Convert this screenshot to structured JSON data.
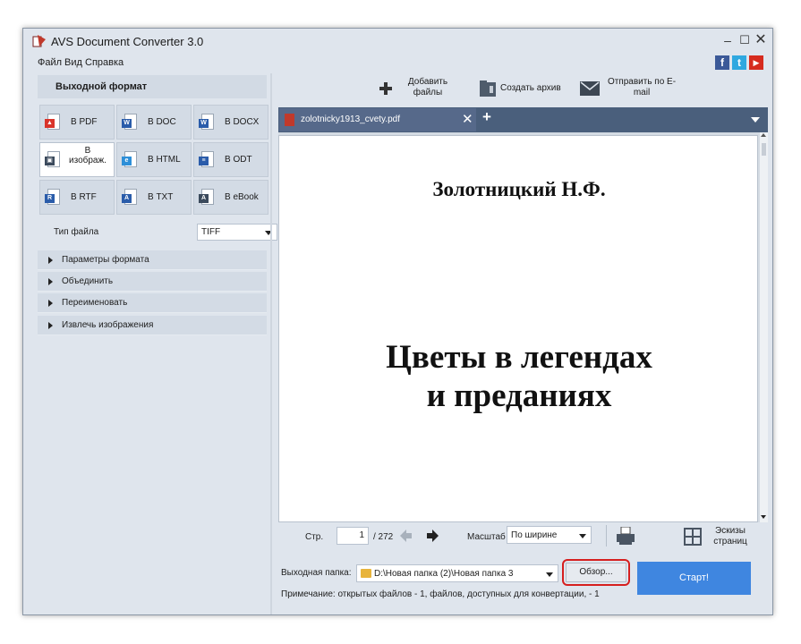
{
  "window": {
    "title": "AVS Document Converter 3.0"
  },
  "menu": [
    "Файл",
    "Вид",
    "Справка"
  ],
  "social_icons": [
    "facebook-icon",
    "twitter-icon",
    "youtube-icon"
  ],
  "left_panel": {
    "header": "Выходной формат",
    "formats": [
      {
        "label": "В PDF",
        "icon": "pdf-icon",
        "color": "#d9342b",
        "selected": false
      },
      {
        "label": "В DOC",
        "icon": "doc-icon",
        "color": "#2a5caa",
        "selected": false
      },
      {
        "label": "В DOCX",
        "icon": "docx-icon",
        "color": "#2a5caa",
        "selected": false
      },
      {
        "label": "В изображ.",
        "icon": "image-icon",
        "color": "#3b4a5c",
        "selected": true
      },
      {
        "label": "В HTML",
        "icon": "html-icon",
        "color": "#2d8fd8",
        "selected": false
      },
      {
        "label": "В ODT",
        "icon": "odt-icon",
        "color": "#2a5caa",
        "selected": false
      },
      {
        "label": "В RTF",
        "icon": "rtf-icon",
        "color": "#2a5caa",
        "selected": false
      },
      {
        "label": "В TXT",
        "icon": "txt-icon",
        "color": "#2a5caa",
        "selected": false
      },
      {
        "label": "В eBook",
        "icon": "ebook-icon",
        "color": "#3b4a5c",
        "selected": false
      }
    ],
    "file_type": {
      "label": "Тип файла",
      "value": "TIFF"
    },
    "sections": [
      "Параметры формата",
      "Объединить",
      "Переименовать",
      "Извлечь изображения"
    ]
  },
  "toolbar": {
    "add_files": "Добавить файлы",
    "create_archive": "Создать архив",
    "send_email": "Отправить по E-mail"
  },
  "document": {
    "tab_name": "zolotnicky1913_cvety.pdf",
    "author": "Золотницкий Н.Ф.",
    "title_line1": "Цветы в легендах",
    "title_line2": "и преданиях"
  },
  "navigation": {
    "page_label": "Стр.",
    "current_page": "1",
    "total_pages": "/ 272",
    "zoom_label": "Масштаб",
    "zoom_value": "По ширине",
    "thumbnails_label": "Эскизы страниц"
  },
  "output": {
    "folder_label": "Выходная папка:",
    "folder_path": "D:\\Новая папка (2)\\Новая папка 3",
    "browse_label": "Обзор...",
    "start_label": "Старт!",
    "note": "Примечание: открытых файлов - 1, файлов, доступных для конвертации, - 1"
  },
  "colors": {
    "accent": "#3f86e0",
    "highlight_ring": "#d61f1f",
    "tab_bar": "#4a5f7c"
  }
}
